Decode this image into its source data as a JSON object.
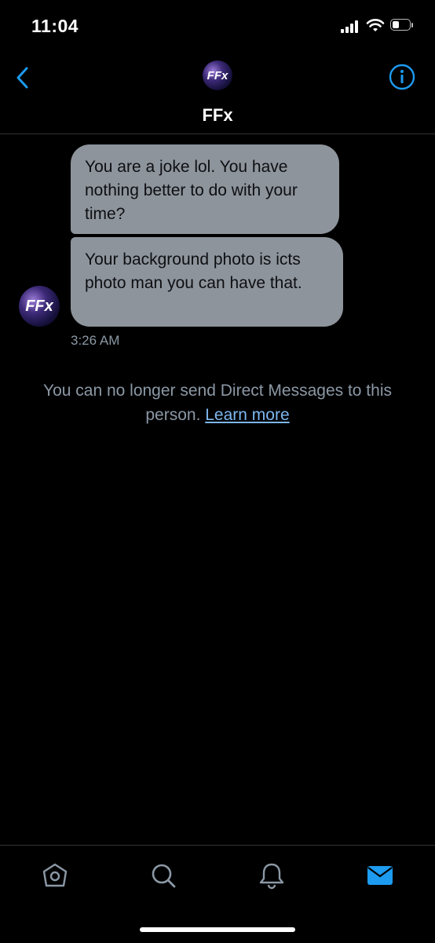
{
  "status": {
    "time": "11:04"
  },
  "header": {
    "avatar_text": "FFx",
    "title": "FFx"
  },
  "conversation": {
    "messages": [
      {
        "text": "You are a joke lol.   You have nothing better to do with your time?"
      },
      {
        "text": "Your background photo is icts photo man you can have that."
      }
    ],
    "avatar_text": "FFx",
    "timestamp": "3:26 AM"
  },
  "notice": {
    "text": "You can no longer send Direct Messages to this person.",
    "link": "Learn more"
  },
  "tabs": [
    {
      "icon": "home-icon"
    },
    {
      "icon": "search-icon"
    },
    {
      "icon": "bell-icon"
    },
    {
      "icon": "mail-icon",
      "active": true
    }
  ],
  "colors": {
    "accent": "#1d9bf0",
    "bubble": "#8e949c",
    "muted_text": "#8b98a5",
    "link": "#7db7f0"
  }
}
